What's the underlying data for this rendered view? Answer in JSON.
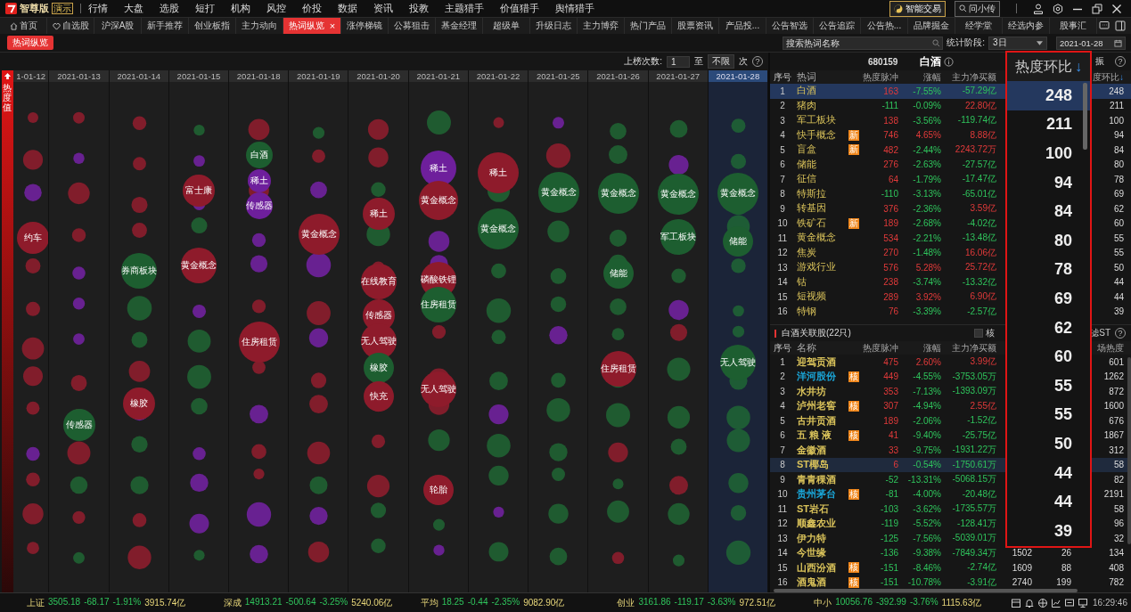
{
  "app": {
    "logo_text": "智尊版",
    "badge": "演示",
    "menu": [
      "行情",
      "大盘",
      "选股",
      "短打",
      "机构",
      "风控",
      "价投",
      "数据",
      "资讯",
      "投教",
      "主题猎手",
      "价值猎手",
      "舆情猎手"
    ],
    "trade_button": "智能交易",
    "search_button": "问小传"
  },
  "tabs": [
    {
      "label": "首页",
      "kind": "home",
      "selected": false
    },
    {
      "label": "自选股",
      "kind": "heart",
      "selected": false
    },
    {
      "label": "沪深A股",
      "kind": "plain",
      "selected": false
    },
    {
      "label": "新手推荐",
      "kind": "plain",
      "selected": false
    },
    {
      "label": "创业板指",
      "kind": "plain",
      "selected": false
    },
    {
      "label": "主力动向",
      "kind": "plain",
      "selected": false
    },
    {
      "label": "热词纵览",
      "kind": "plain",
      "selected": true,
      "close_glyph": "×"
    },
    {
      "label": "涨停梯镜",
      "kind": "plain",
      "selected": false
    },
    {
      "label": "公募狙击",
      "kind": "plain",
      "selected": false
    },
    {
      "label": "基金经理",
      "kind": "plain",
      "selected": false
    },
    {
      "label": "超级单",
      "kind": "plain",
      "selected": false
    },
    {
      "label": "升级日志",
      "kind": "plain",
      "selected": false
    },
    {
      "label": "主力博弈",
      "kind": "plain",
      "selected": false
    },
    {
      "label": "热门产品",
      "kind": "plain",
      "selected": false
    },
    {
      "label": "股票资讯",
      "kind": "plain",
      "selected": false
    },
    {
      "label": "产品投...",
      "kind": "plain",
      "selected": false
    },
    {
      "label": "公告智选",
      "kind": "plain",
      "selected": false
    },
    {
      "label": "公告追踪",
      "kind": "plain",
      "selected": false
    },
    {
      "label": "公告热...",
      "kind": "plain",
      "selected": false
    },
    {
      "label": "品牌掘金",
      "kind": "plain",
      "selected": false
    },
    {
      "label": "经学堂",
      "kind": "plain",
      "selected": false
    },
    {
      "label": "经选内参",
      "kind": "plain",
      "selected": false
    },
    {
      "label": "股事汇",
      "kind": "plain",
      "selected": false
    }
  ],
  "page_chip": "热词纵览",
  "filters": {
    "search": {
      "placeholder": "搜索热词名称"
    },
    "period_label": "统计阶段:",
    "period": "3日",
    "date": "2021-01-28"
  },
  "chart_controls": {
    "label": "上榜次数:",
    "from": "1",
    "to_label": "至",
    "to": "不限",
    "unit": "次",
    "help_mark": "?"
  },
  "axis_label": "热度值",
  "columns": [
    {
      "date": "1-01-12",
      "selected": false,
      "bubbles": [
        {
          "label": "约车",
          "color": "#8e1b2b"
        }
      ]
    },
    {
      "date": "2021-01-13",
      "selected": false,
      "bubbles": [
        {
          "label": "传感器",
          "color": "#1d5e30"
        }
      ]
    },
    {
      "date": "2021-01-14",
      "selected": false,
      "bubbles": [
        {
          "label": "券商板块",
          "color": "#1d5e30"
        },
        {
          "label": "橡胶",
          "color": "#8e1b2b"
        }
      ]
    },
    {
      "date": "2021-01-15",
      "selected": false,
      "bubbles": [
        {
          "label": "富士康",
          "color": "#8e1b2b"
        },
        {
          "label": "黄金概念",
          "color": "#8e1b2b"
        }
      ]
    },
    {
      "date": "2021-01-18",
      "selected": false,
      "bubbles": [
        {
          "label": "白酒",
          "color": "#1d5e30"
        },
        {
          "label": "稀土",
          "color": "#6e1f9c"
        },
        {
          "label": "传感器",
          "color": "#6e1f9c"
        },
        {
          "label": "住房租赁",
          "color": "#8e1b2b"
        }
      ]
    },
    {
      "date": "2021-01-19",
      "selected": false,
      "bubbles": [
        {
          "label": "黄金概念",
          "color": "#8e1b2b"
        }
      ]
    },
    {
      "date": "2021-01-20",
      "selected": false,
      "bubbles": [
        {
          "label": "稀土",
          "color": "#8e1b2b"
        },
        {
          "label": "在线教育",
          "color": "#8e1b2b"
        },
        {
          "label": "传感器",
          "color": "#8e1b2b"
        },
        {
          "label": "无人驾驶",
          "color": "#8e1b2b"
        },
        {
          "label": "橡胶",
          "color": "#1d5e30"
        },
        {
          "label": "快充",
          "color": "#8e1b2b"
        }
      ]
    },
    {
      "date": "2021-01-21",
      "selected": false,
      "bubbles": [
        {
          "label": "稀土",
          "color": "#6e1f9c"
        },
        {
          "label": "黄金概念",
          "color": "#8e1b2b"
        },
        {
          "label": "磷酸铁锂",
          "color": "#8e1b2b"
        },
        {
          "label": "住房租赁",
          "color": "#1d5e30"
        },
        {
          "label": "无人驾驶",
          "color": "#8e1b2b"
        },
        {
          "label": "轮胎",
          "color": "#8e1b2b"
        }
      ]
    },
    {
      "date": "2021-01-22",
      "selected": false,
      "bubbles": [
        {
          "label": "稀土",
          "color": "#8e1b2b"
        },
        {
          "label": "黄金概念",
          "color": "#1d5e30"
        }
      ]
    },
    {
      "date": "2021-01-25",
      "selected": false,
      "bubbles": [
        {
          "label": "黄金概念",
          "color": "#1d5e30"
        }
      ]
    },
    {
      "date": "2021-01-26",
      "selected": false,
      "bubbles": [
        {
          "label": "黄金概念",
          "color": "#1d5e30"
        },
        {
          "label": "储能",
          "color": "#1d5e30"
        },
        {
          "label": "住房租赁",
          "color": "#8e1b2b"
        }
      ]
    },
    {
      "date": "2021-01-27",
      "selected": false,
      "bubbles": [
        {
          "label": "黄金概念",
          "color": "#1d5e30"
        },
        {
          "label": "军工板块",
          "color": "#1d5e30"
        }
      ]
    },
    {
      "date": "2021-01-28",
      "selected": true,
      "bubbles": [
        {
          "label": "黄金概念",
          "color": "#1d5e30"
        },
        {
          "label": "储能",
          "color": "#1d5e30"
        },
        {
          "label": "无人驾驶",
          "color": "#1d5e30"
        }
      ]
    }
  ],
  "hot_words": {
    "code": "680159",
    "name": "白酒",
    "right_label": "振",
    "help_mark": "?",
    "columns": [
      "序号",
      "热词",
      "热度脉冲",
      "涨幅",
      "主力净买额",
      "度环比"
    ],
    "sort_arrow": "↓",
    "rows": [
      {
        "no": "1",
        "word": "白酒",
        "pulse": "163",
        "change": "-7.55%",
        "net_buy": "-57.29亿",
        "ratio": "248",
        "selected": true
      },
      {
        "no": "2",
        "word": "猪肉",
        "pulse": "-111",
        "change": "-0.09%",
        "net_buy": "22.80亿",
        "ratio": "211",
        "selected": false
      },
      {
        "no": "3",
        "word": "军工板块",
        "pulse": "138",
        "change": "-3.56%",
        "net_buy": "-119.74亿",
        "ratio": "100",
        "selected": false
      },
      {
        "no": "4",
        "word": "快手概念",
        "badge": "新",
        "pulse": "746",
        "change": "4.65%",
        "net_buy": "8.88亿",
        "ratio": "94",
        "selected": false
      },
      {
        "no": "5",
        "word": "盲盒",
        "badge": "新",
        "pulse": "482",
        "change": "-2.44%",
        "net_buy": "2243.72万",
        "ratio": "84",
        "selected": false
      },
      {
        "no": "6",
        "word": "储能",
        "pulse": "276",
        "change": "-2.63%",
        "net_buy": "-27.57亿",
        "ratio": "80",
        "selected": false
      },
      {
        "no": "7",
        "word": "征信",
        "pulse": "64",
        "change": "-1.79%",
        "net_buy": "-17.47亿",
        "ratio": "78",
        "selected": false
      },
      {
        "no": "8",
        "word": "特斯拉",
        "pulse": "-110",
        "change": "-3.13%",
        "net_buy": "-65.01亿",
        "ratio": "69",
        "selected": false
      },
      {
        "no": "9",
        "word": "转基因",
        "pulse": "376",
        "change": "-2.36%",
        "net_buy": "3.59亿",
        "ratio": "62",
        "selected": false
      },
      {
        "no": "10",
        "word": "铁矿石",
        "badge": "新",
        "pulse": "189",
        "change": "-2.68%",
        "net_buy": "-4.02亿",
        "ratio": "60",
        "selected": false
      },
      {
        "no": "11",
        "word": "黄金概念",
        "pulse": "534",
        "change": "-2.21%",
        "net_buy": "-13.48亿",
        "ratio": "55",
        "selected": false
      },
      {
        "no": "12",
        "word": "焦炭",
        "pulse": "270",
        "change": "-1.48%",
        "net_buy": "16.06亿",
        "ratio": "55",
        "selected": false
      },
      {
        "no": "13",
        "word": "游戏行业",
        "pulse": "576",
        "change": "5.28%",
        "net_buy": "25.72亿",
        "ratio": "50",
        "selected": false
      },
      {
        "no": "14",
        "word": "钴",
        "pulse": "238",
        "change": "-3.74%",
        "net_buy": "-13.32亿",
        "ratio": "44",
        "selected": false
      },
      {
        "no": "15",
        "word": "短视频",
        "pulse": "289",
        "change": "3.92%",
        "net_buy": "6.90亿",
        "ratio": "44",
        "selected": false
      },
      {
        "no": "16",
        "word": "特钢",
        "pulse": "76",
        "change": "-3.39%",
        "net_buy": "-2.57亿",
        "ratio": "39",
        "selected": false
      }
    ]
  },
  "related": {
    "title": "白酒关联股(22只)",
    "checkbox": {
      "label": "核",
      "checked": false
    },
    "filter_label": "滤ST",
    "help_mark": "?",
    "columns": [
      "序号",
      "名称",
      "热度脉冲",
      "涨幅",
      "主力净买额",
      "场热度"
    ],
    "rows": [
      {
        "no": "1",
        "name": "迎驾贡酒",
        "color": "#d9c25a",
        "pulse": "475",
        "change": "2.60%",
        "net_buy": "3.99亿",
        "heat": "601",
        "selected": false
      },
      {
        "no": "2",
        "name": "洋河股份",
        "color": "#1aa6d8",
        "badge": "核",
        "pulse": "449",
        "change": "-4.55%",
        "net_buy": "-3753.05万",
        "heat": "1262",
        "selected": false
      },
      {
        "no": "3",
        "name": "水井坊",
        "color": "#d9c25a",
        "pulse": "353",
        "change": "-7.13%",
        "net_buy": "-1393.09万",
        "heat": "872",
        "selected": false
      },
      {
        "no": "4",
        "name": "泸州老窖",
        "color": "#d9c25a",
        "badge": "核",
        "pulse": "307",
        "change": "-4.94%",
        "net_buy": "2.55亿",
        "heat": "1600",
        "selected": false
      },
      {
        "no": "5",
        "name": "古井贡酒",
        "color": "#d9c25a",
        "pulse": "189",
        "change": "-2.06%",
        "net_buy": "-1.52亿",
        "heat": "676",
        "selected": false
      },
      {
        "no": "6",
        "name": "五 粮 液",
        "color": "#d9c25a",
        "badge": "核",
        "pulse": "41",
        "change": "-9.40%",
        "net_buy": "-25.75亿",
        "heat": "1867",
        "selected": false
      },
      {
        "no": "7",
        "name": "金徽酒",
        "color": "#d9c25a",
        "pulse": "33",
        "change": "-9.75%",
        "net_buy": "-1931.22万",
        "heat": "312",
        "selected": false
      },
      {
        "no": "8",
        "name": "ST椰岛",
        "color": "#d9c25a",
        "pulse": "6",
        "change": "-0.54%",
        "net_buy": "-1750.61万",
        "heat": "58",
        "selected": true
      },
      {
        "no": "9",
        "name": "青青稞酒",
        "color": "#d9c25a",
        "pulse": "-52",
        "change": "-13.31%",
        "net_buy": "-5068.15万",
        "heat": "82",
        "selected": false
      },
      {
        "no": "10",
        "name": "贵州茅台",
        "color": "#1aa6d8",
        "badge": "核",
        "pulse": "-81",
        "change": "-4.00%",
        "net_buy": "-20.48亿",
        "heat": "2191",
        "selected": false
      },
      {
        "no": "11",
        "name": "ST岩石",
        "color": "#d9c25a",
        "pulse": "-103",
        "change": "-3.62%",
        "net_buy": "-1735.57万",
        "heat": "58",
        "selected": false
      },
      {
        "no": "12",
        "name": "顺鑫农业",
        "color": "#d9c25a",
        "pulse": "-119",
        "change": "-5.52%",
        "net_buy": "-128.41万",
        "heat": "96",
        "selected": false
      },
      {
        "no": "13",
        "name": "伊力特",
        "color": "#d9c25a",
        "pulse": "-125",
        "change": "-7.56%",
        "net_buy": "-5039.01万",
        "heat": "32",
        "selected": false
      },
      {
        "no": "14",
        "name": "今世缘",
        "color": "#d9c25a",
        "pulse": "-136",
        "change": "-9.38%",
        "net_buy": "-7849.34万",
        "column_6": "1502",
        "column_7": "26",
        "heat": "134",
        "selected": false
      },
      {
        "no": "15",
        "name": "山西汾酒",
        "color": "#d9c25a",
        "badge": "核",
        "pulse": "-151",
        "change": "-8.46%",
        "net_buy": "-2.74亿",
        "column_6": "1609",
        "column_7": "88",
        "heat": "408",
        "selected": false
      },
      {
        "no": "16",
        "name": "酒鬼酒",
        "color": "#d9c25a",
        "badge": "核",
        "pulse": "-151",
        "change": "-10.78%",
        "net_buy": "-3.91亿",
        "column_6": "2740",
        "column_7": "199",
        "heat": "782",
        "selected": false
      }
    ]
  },
  "callout": {
    "header": "热度环比",
    "sort_arrow": "↓",
    "values": [
      {
        "value": "248",
        "selected": true
      },
      {
        "value": "211",
        "selected": false
      },
      {
        "value": "100",
        "selected": false
      },
      {
        "value": "94",
        "selected": false
      },
      {
        "value": "84",
        "selected": false
      },
      {
        "value": "80",
        "selected": false
      },
      {
        "value": "78",
        "selected": false
      },
      {
        "value": "69",
        "selected": false
      },
      {
        "value": "62",
        "selected": false
      },
      {
        "value": "60",
        "selected": false
      },
      {
        "value": "55",
        "selected": false
      },
      {
        "value": "55",
        "selected": false
      },
      {
        "value": "50",
        "selected": false
      },
      {
        "value": "44",
        "selected": false
      },
      {
        "value": "44",
        "selected": false
      },
      {
        "value": "39",
        "selected": false
      }
    ]
  },
  "status_bar": {
    "indices": [
      {
        "name": "上证",
        "value": "3505.18",
        "change": "-68.17",
        "percent": "-1.91%",
        "turnover": "3915.74亿"
      },
      {
        "name": "深成",
        "value": "14913.21",
        "change": "-500.64",
        "percent": "-3.25%",
        "turnover": "5240.06亿"
      },
      {
        "name": "平均",
        "value": "18.25",
        "change": "-0.44",
        "percent": "-2.35%",
        "turnover": "9082.90亿"
      },
      {
        "name": "创业",
        "value": "3161.86",
        "change": "-119.17",
        "percent": "-3.63%",
        "turnover": "972.51亿"
      },
      {
        "name": "中小",
        "value": "10056.76",
        "change": "-392.99",
        "percent": "-3.76%",
        "turnover": "1115.63亿"
      }
    ],
    "time": "16:29:46"
  }
}
